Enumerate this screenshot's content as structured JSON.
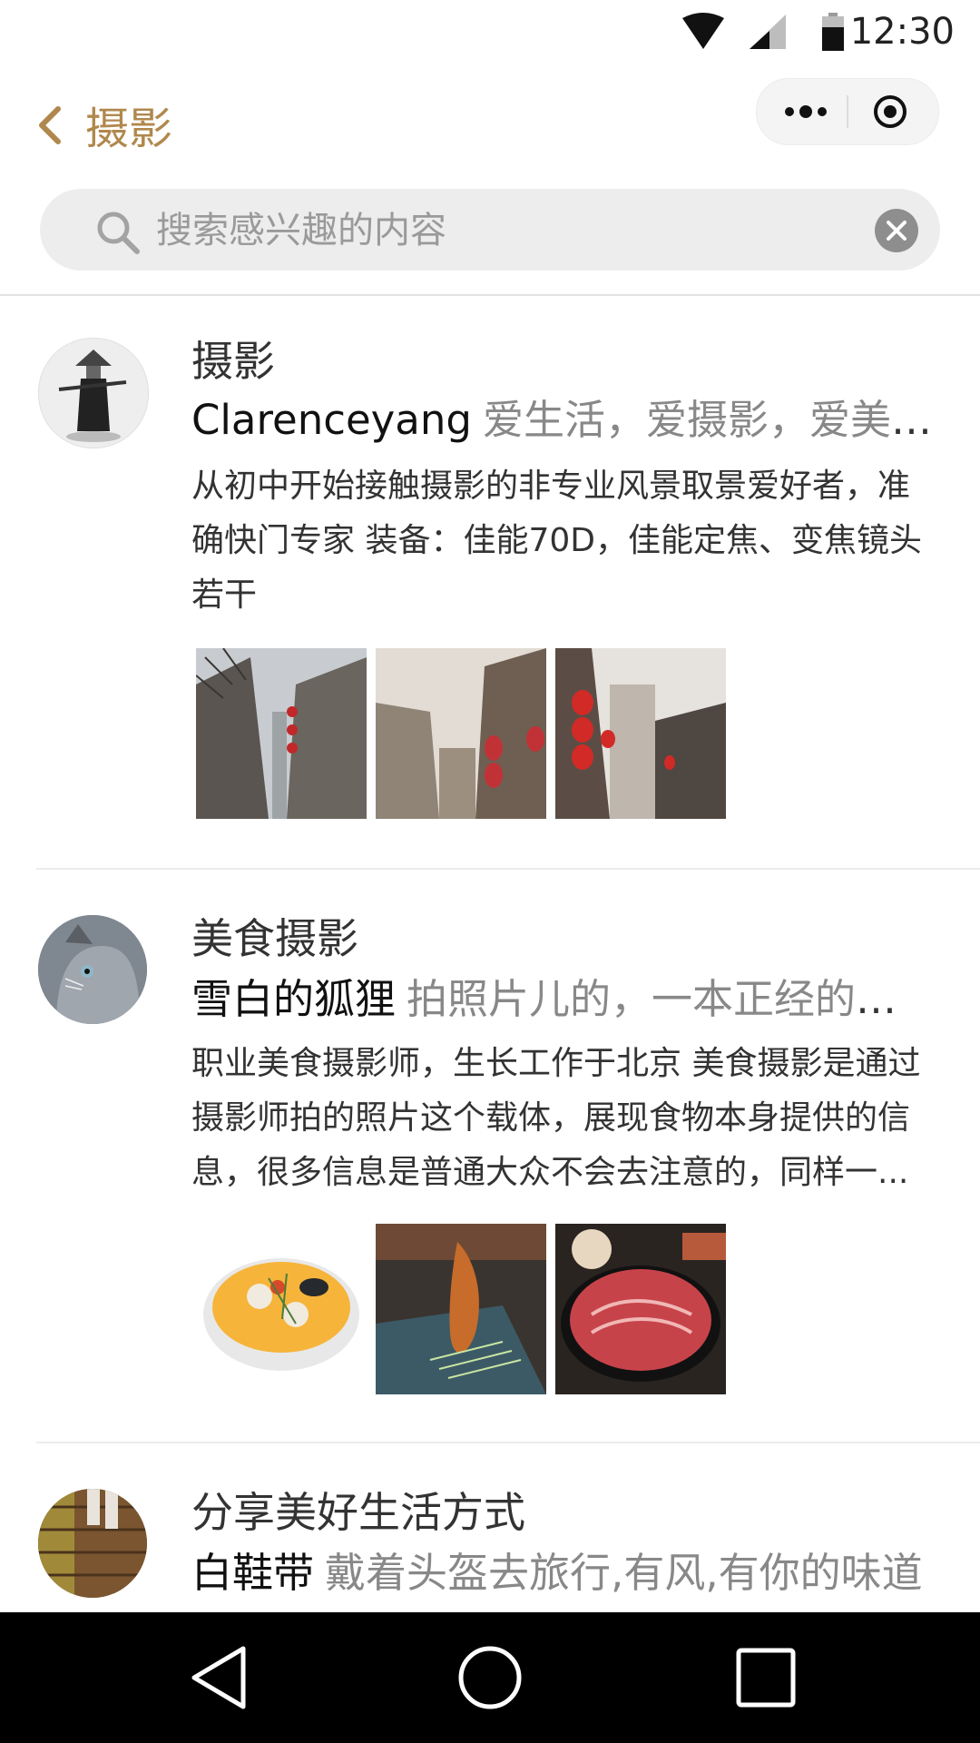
{
  "status_bar": {
    "time": "12:30"
  },
  "header": {
    "title": "摄影"
  },
  "search": {
    "placeholder": "搜索感兴趣的内容"
  },
  "feed": [
    {
      "title": "摄影",
      "author": "Clarenceyang",
      "motto": "爱生活，爱摄影，爱美食...",
      "description": "从初中开始接触摄影的非专业风景取景爱好者，准确快门专家 装备：佳能70D，佳能定焦、变焦镜头若干"
    },
    {
      "title": "美食摄影",
      "author": "雪白的狐狸",
      "motto": "拍照片儿的，一本正经的卖萌",
      "description": "职业美食摄影师，生长工作于北京 美食摄影是通过摄影师拍的照片这个载体，展现食物本身提供的信息，很多信息是普通大众不会去注意的，同样一..."
    },
    {
      "title": "分享美好生活方式",
      "author": "白鞋带",
      "motto": "戴着头盔去旅行,有风,有你的味道"
    }
  ],
  "colors": {
    "accent": "#b0884d",
    "navbar": "#000000"
  }
}
